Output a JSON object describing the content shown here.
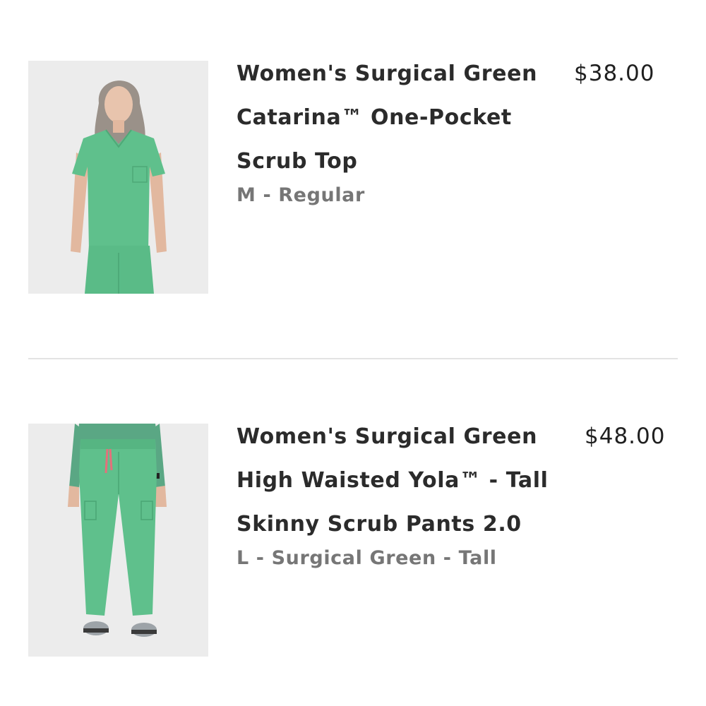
{
  "cart": {
    "items": [
      {
        "title_lines": [
          "Women's Surgical Green",
          "Catarina™ One-Pocket",
          "Scrub Top"
        ],
        "variant": "M - Regular",
        "price": "$38.00",
        "image_icon": "scrub-top-photo",
        "garment_color": "#5fc08c"
      },
      {
        "title_lines": [
          "Women's Surgical Green",
          "High Waisted Yola™ - Tall",
          "Skinny Scrub Pants 2.0"
        ],
        "variant": "L - Surgical Green - Tall",
        "price": "$48.00",
        "image_icon": "scrub-pants-photo",
        "garment_color": "#5fc08c"
      }
    ]
  }
}
